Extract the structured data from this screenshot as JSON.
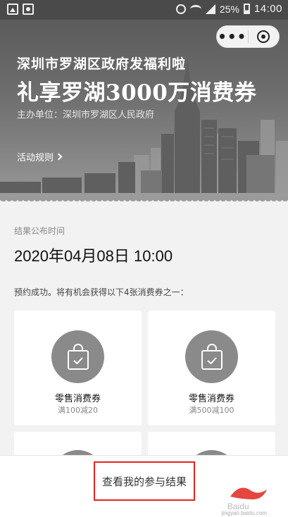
{
  "status_bar": {
    "battery": "25%",
    "time": "14:00"
  },
  "banner": {
    "title_line1": "深圳市罗湖区政府发福利啦",
    "title_line2": "礼享罗湖3000万消费券",
    "organizer": "主办单位：深圳市罗湖区人民政府",
    "rules_link": "活动规则",
    "menu_dots": "•••"
  },
  "result": {
    "publish_label": "结果公布时间",
    "publish_time": "2020年04月08日 10:00",
    "info": "预约成功。将有机会获得以下4张消费券之一："
  },
  "coupons": [
    {
      "name": "零售消费券",
      "condition": "满100减20",
      "icon": "shopping-bag-check-icon"
    },
    {
      "name": "零售消费券",
      "condition": "满500减100",
      "icon": "shopping-bag-check-icon"
    },
    {
      "name": "",
      "condition": "",
      "icon": "shopping-bag-check-icon"
    },
    {
      "name": "",
      "condition": "",
      "icon": "shopping-bag-check-icon"
    }
  ],
  "bottom": {
    "view_results_button": "查看我的参与结果",
    "watermark_text": "jingyan.baidu.com"
  },
  "colors": {
    "highlight_border": "#e0261f",
    "coupon_icon_circle": "#8a8a8a"
  }
}
